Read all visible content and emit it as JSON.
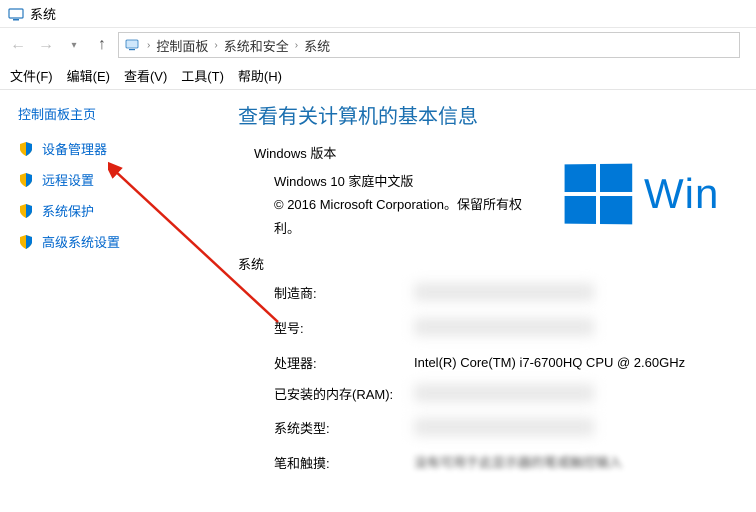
{
  "window": {
    "title": "系统"
  },
  "breadcrumb": {
    "root_icon": "control-panel-icon",
    "items": [
      "控制面板",
      "系统和安全",
      "系统"
    ]
  },
  "menu": {
    "file": "文件(F)",
    "edit": "编辑(E)",
    "view": "查看(V)",
    "tools": "工具(T)",
    "help": "帮助(H)"
  },
  "sidebar": {
    "home": "控制面板主页",
    "items": [
      {
        "label": "设备管理器"
      },
      {
        "label": "远程设置"
      },
      {
        "label": "系统保护"
      },
      {
        "label": "高级系统设置"
      }
    ]
  },
  "content": {
    "heading": "查看有关计算机的基本信息",
    "edition_section": "Windows 版本",
    "edition_name": "Windows 10 家庭中文版",
    "copyright": "© 2016 Microsoft Corporation。保留所有权利。",
    "brand_text": "Win",
    "system_section": "系统",
    "rows": {
      "manufacturer_key": "制造商:",
      "model_key": "型号:",
      "processor_key": "处理器:",
      "processor_val": "Intel(R) Core(TM) i7-6700HQ CPU @ 2.60GHz",
      "ram_key": "已安装的内存(RAM):",
      "system_type_key": "系统类型:",
      "pen_touch_key": "笔和触摸:",
      "pen_touch_val": "没有可用于此显示器的笔或触控输入"
    }
  }
}
